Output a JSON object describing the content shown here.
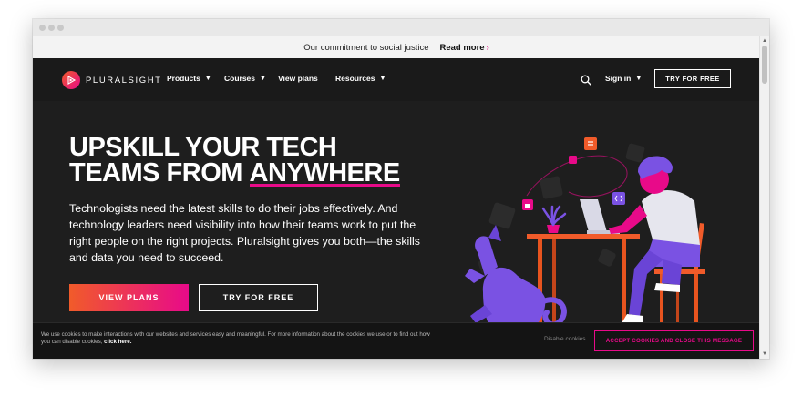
{
  "announcement": {
    "text": "Our commitment to social justice",
    "link": "Read more",
    "link_chevron": "›"
  },
  "nav": {
    "logo_text": "PLURALSIGHT",
    "items": [
      "Products",
      "Courses",
      "View plans",
      "Resources"
    ],
    "sign_in": "Sign in",
    "try_free": "TRY FOR FREE"
  },
  "hero": {
    "headline_line1": "UPSKILL YOUR TECH",
    "headline_line2_prefix": "TEAMS FROM ",
    "headline_line2_highlight": "ANYWHERE",
    "description": "Technologists need the latest skills to do their jobs effectively. And technology leaders need visibility into how their teams work to put the right people on the right projects. Pluralsight gives you both—the skills and data you need to succeed.",
    "cta_primary": "VIEW PLANS",
    "cta_secondary": "TRY FOR FREE"
  },
  "cookie": {
    "text": "We use cookies to make interactions with our websites and services easy and meaningful. For more information about the cookies we use or to find out how you can disable cookies,",
    "link": "click here.",
    "disable": "Disable cookies",
    "accept": "ACCEPT COOKIES AND CLOSE THIS MESSAGE"
  },
  "icons": {
    "caret": "chevron-down-icon",
    "search": "search-icon",
    "logo": "pluralsight-logo-icon"
  },
  "colors": {
    "accent_pink": "#e80a89",
    "accent_orange": "#f15b2a",
    "background": "#1e1e1e",
    "illustration_purple": "#7a52e3"
  }
}
